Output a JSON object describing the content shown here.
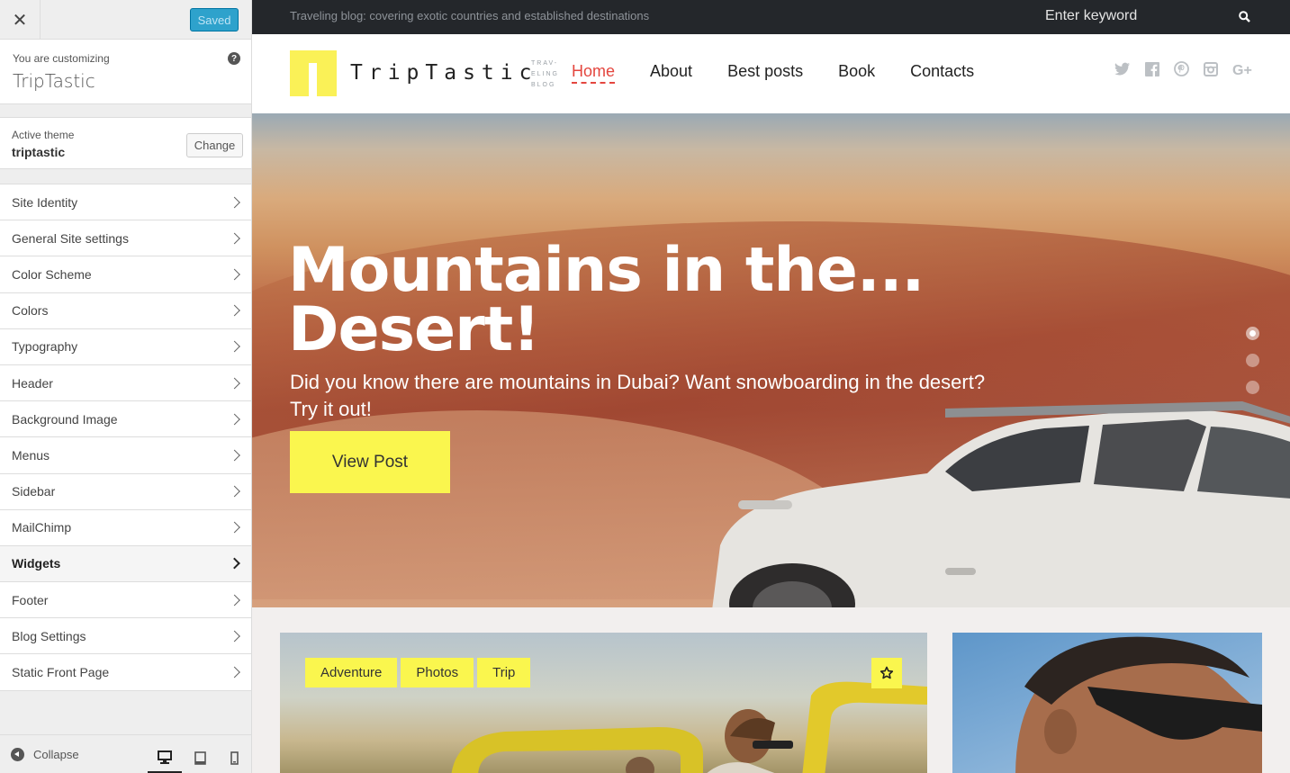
{
  "customizer": {
    "close_icon": "close-icon",
    "saved_label": "Saved",
    "customizing_label": "You are customizing",
    "site_name": "TripTastic",
    "help_icon": "help-icon",
    "active_theme_label": "Active theme",
    "active_theme_name": "triptastic",
    "change_label": "Change",
    "sections": [
      {
        "label": "Site Identity"
      },
      {
        "label": "General Site settings"
      },
      {
        "label": "Color Scheme"
      },
      {
        "label": "Colors"
      },
      {
        "label": "Typography"
      },
      {
        "label": "Header"
      },
      {
        "label": "Background Image"
      },
      {
        "label": "Menus"
      },
      {
        "label": "Sidebar"
      },
      {
        "label": "MailChimp"
      },
      {
        "label": "Widgets",
        "active": true
      },
      {
        "label": "Footer"
      },
      {
        "label": "Blog Settings"
      },
      {
        "label": "Static Front Page"
      }
    ],
    "collapse_label": "Collapse",
    "devices": [
      "desktop-icon",
      "tablet-icon",
      "mobile-icon"
    ],
    "selected_device": "desktop"
  },
  "site": {
    "tagline": "Traveling blog: covering exotic countries and established destinations",
    "search_placeholder": "Enter keyword",
    "logo_text": "TripTastic",
    "logo_sub": "TRAV-ELING BLOG",
    "nav": [
      {
        "label": "Home",
        "current": true
      },
      {
        "label": "About"
      },
      {
        "label": "Best posts"
      },
      {
        "label": "Book"
      },
      {
        "label": "Contacts"
      }
    ],
    "social_icons": [
      "twitter-icon",
      "facebook-icon",
      "pinterest-icon",
      "instagram-icon",
      "google-plus-icon"
    ],
    "accent_color": "#faf64e",
    "nav_active_color": "#e4463f"
  },
  "hero": {
    "title_line1": "Mountains in the...",
    "title_line2": "Desert!",
    "subtitle": "Did you know there are mountains in Dubai? Want snowboarding in the desert? Try it out!",
    "button_label": "View Post",
    "slide_count": 3,
    "active_slide": 1
  },
  "post": {
    "tags": [
      "Adventure",
      "Photos",
      "Trip"
    ],
    "star_icon": "star-icon"
  }
}
